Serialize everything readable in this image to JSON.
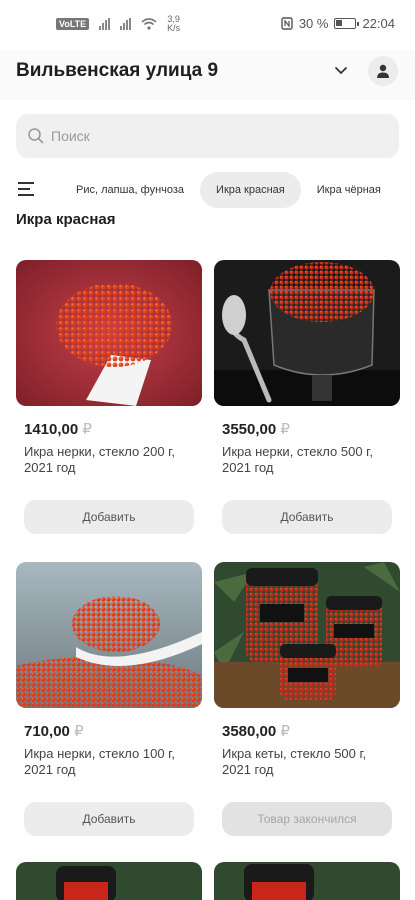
{
  "status": {
    "network_badge": "VoLTE",
    "speed_value": "3,9",
    "speed_unit": "K/s",
    "battery_percent": "30 %",
    "time": "22:04"
  },
  "header": {
    "address": "Вильвенская улица 9"
  },
  "search": {
    "placeholder": "Поиск"
  },
  "categories": [
    {
      "label": "Рис, лапша, фунчоза",
      "active": false
    },
    {
      "label": "Икра красная",
      "active": true
    },
    {
      "label": "Икра чёрная",
      "active": false
    }
  ],
  "section": {
    "title": "Икра красная"
  },
  "products": [
    {
      "price": "1410,00",
      "currency": "₽",
      "name": "Икра нерки, стекло 200 г, 2021 год",
      "button": "Добавить",
      "available": true
    },
    {
      "price": "3550,00",
      "currency": "₽",
      "name": "Икра нерки, стекло 500 г, 2021 год",
      "button": "Добавить",
      "available": true
    },
    {
      "price": "710,00",
      "currency": "₽",
      "name": "Икра нерки, стекло 100 г, 2021 год",
      "button": "Добавить",
      "available": true
    },
    {
      "price": "3580,00",
      "currency": "₽",
      "name": "Икра кеты, стекло 500 г, 2021 год",
      "button": "Товар закончился",
      "available": false
    }
  ],
  "colors": {
    "accent_bg": "#ececec",
    "caviar": "#d8321c"
  }
}
